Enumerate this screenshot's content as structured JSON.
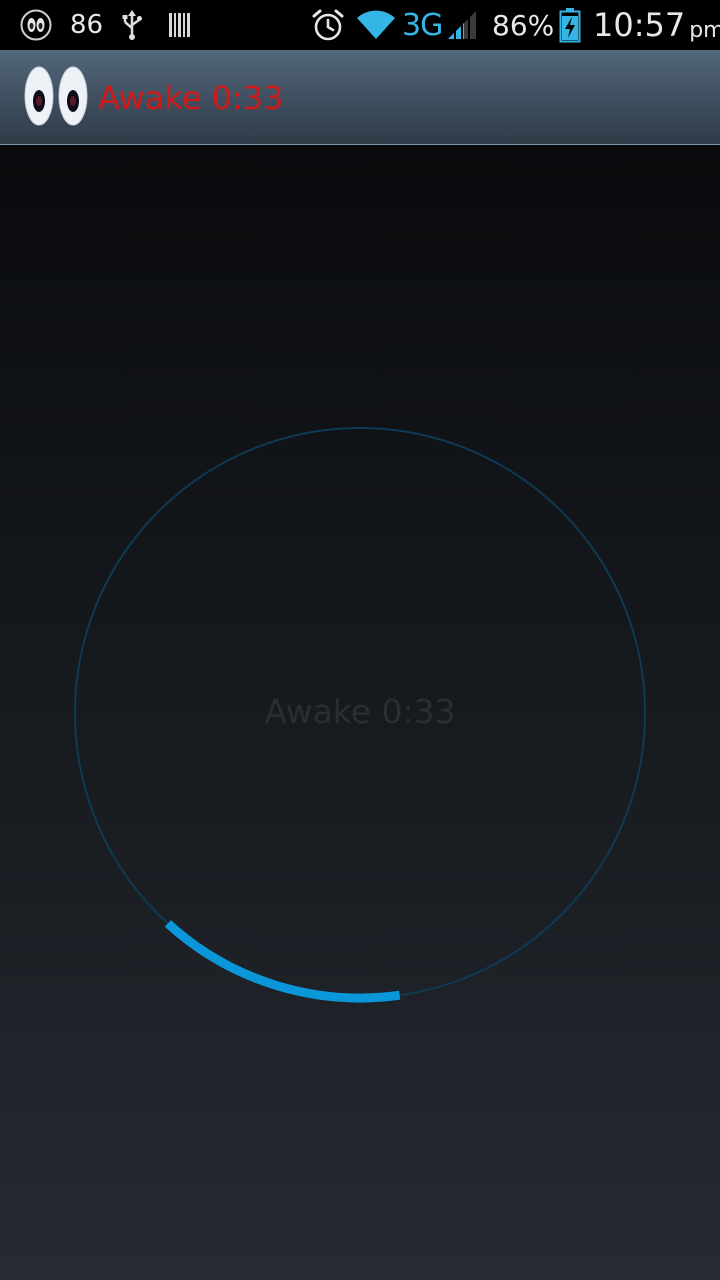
{
  "status_bar": {
    "app_notification_icon": "eyes-icon",
    "battery_level_small": "86",
    "usb_icon": "usb-icon",
    "barcode_icon": "barcode-icon",
    "alarm_icon": "alarm-clock-icon",
    "wifi_icon": "wifi-icon",
    "network_type": "3G",
    "signal_icon": "signal-bars-icon",
    "battery_percent": "86%",
    "battery_icon": "battery-charging-icon",
    "time": "10:57",
    "ampm": "pm",
    "accent_color": "#33b5e5"
  },
  "action_bar": {
    "app_icon": "eyes-icon",
    "title": "Awake 0:33",
    "title_color": "#d01a1a"
  },
  "timer": {
    "label": "Awake 0:33",
    "progress_fraction": 0.14,
    "progress_color": "#0a97d9",
    "track_color": "#0e3a54"
  }
}
